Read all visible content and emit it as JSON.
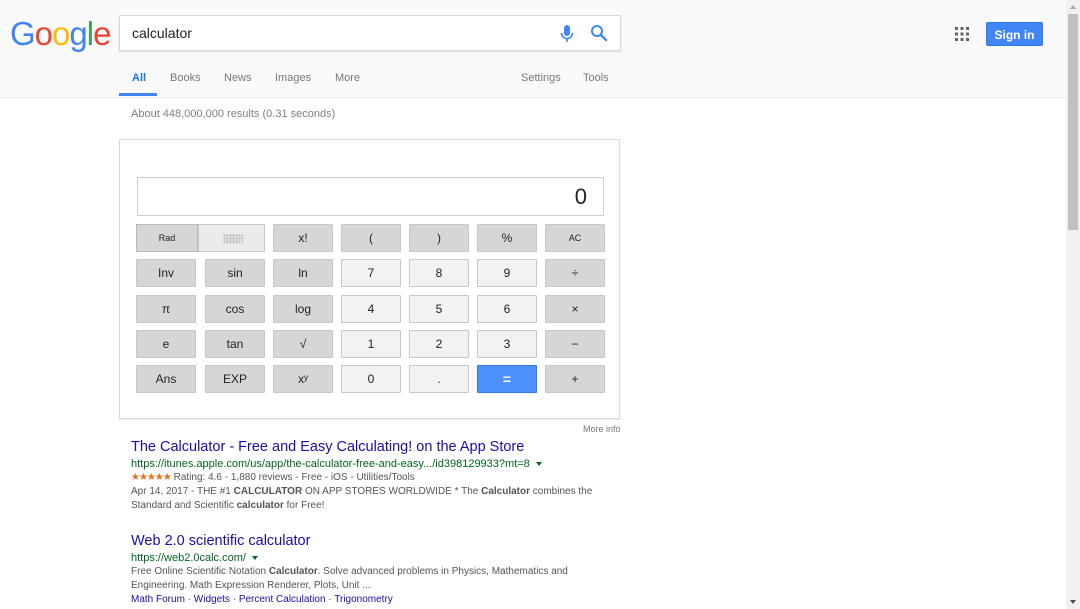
{
  "logo": {
    "letters": [
      "G",
      "o",
      "o",
      "g",
      "l",
      "e"
    ],
    "colors": [
      "#4285f4",
      "#ea4335",
      "#fbbc05",
      "#4285f4",
      "#34a853",
      "#ea4335"
    ]
  },
  "search": {
    "query": "calculator"
  },
  "header": {
    "signin_label": "Sign in"
  },
  "tabs": {
    "all": "All",
    "books": "Books",
    "news": "News",
    "images": "Images",
    "more": "More",
    "settings": "Settings",
    "tools": "Tools"
  },
  "result_stats": "About 448,000,000 results (0.31 seconds)",
  "calculator": {
    "display": "0",
    "rad_label": "Rad",
    "keys": {
      "factorial": "x!",
      "lparen": "(",
      "rparen": ")",
      "percent": "%",
      "ac": "AC",
      "inv": "Inv",
      "sin": "sin",
      "ln": "ln",
      "seven": "7",
      "eight": "8",
      "nine": "9",
      "divide": "÷",
      "pi": "π",
      "cos": "cos",
      "log": "log",
      "four": "4",
      "five": "5",
      "six": "6",
      "multiply": "×",
      "e": "e",
      "tan": "tan",
      "sqrt": "√",
      "one": "1",
      "two": "2",
      "three": "3",
      "minus": "−",
      "ans": "Ans",
      "exp": "EXP",
      "power": "xʸ",
      "zero": "0",
      "dot": ".",
      "equals": "=",
      "plus": "+"
    }
  },
  "more_info": "More info",
  "results": [
    {
      "title": "The Calculator - Free and Easy Calculating! on the App Store",
      "url": "https://itunes.apple.com/us/app/the-calculator-free-and-easy.../id398129933?mt=8",
      "stars": "★★★★★",
      "rating_text": "Rating: 4.6 - 1,880 reviews - Free - iOS - Utilities/Tools",
      "snippet": [
        [
          {
            "t": "Apr 14, 2017 - THE #1 ",
            "b": false
          },
          {
            "t": "CALCULATOR",
            "b": true
          },
          {
            "t": " ON APP STORES WORLDWIDE * The ",
            "b": false
          },
          {
            "t": "Calculator",
            "b": true
          },
          {
            "t": " combines the",
            "b": false
          }
        ],
        [
          {
            "t": "Standard and Scientific ",
            "b": false
          },
          {
            "t": "calculator",
            "b": true
          },
          {
            "t": " for Free!",
            "b": false
          }
        ]
      ]
    },
    {
      "title": "Web 2.0 scientific calculator",
      "url": "https://web2.0calc.com/",
      "snippet": [
        [
          {
            "t": "Free Online Scientific Notation ",
            "b": false
          },
          {
            "t": "Calculator",
            "b": true
          },
          {
            "t": ". Solve advanced problems in Physics, Mathematics and",
            "b": false
          }
        ],
        [
          {
            "t": "Engineering. Math Expression Renderer, Plots, Unit ...",
            "b": false
          }
        ]
      ],
      "sitelinks": [
        "Math Forum",
        "Widgets",
        "Percent Calculation",
        "Trigonometry"
      ],
      "sitelink_separator": " · "
    }
  ]
}
